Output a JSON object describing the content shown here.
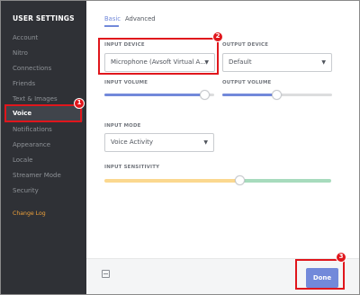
{
  "sidebar": {
    "title": "USER SETTINGS",
    "items": [
      "Account",
      "Nitro",
      "Connections",
      "Friends",
      "Text & Images",
      "Voice",
      "Notifications",
      "Appearance",
      "Locale",
      "Streamer Mode",
      "Security"
    ],
    "active_index": 5,
    "changelog_label": "Change Log"
  },
  "tabs": {
    "basic": "Basic",
    "advanced": "Advanced"
  },
  "input_device": {
    "label": "INPUT DEVICE",
    "value": "Microphone (Avsoft Virtual A..."
  },
  "output_device": {
    "label": "OUTPUT DEVICE",
    "value": "Default"
  },
  "input_volume": {
    "label": "INPUT VOLUME",
    "level_percent": 100
  },
  "output_volume": {
    "label": "OUTPUT VOLUME",
    "level_percent": 50
  },
  "input_mode": {
    "label": "INPUT MODE",
    "value": "Voice Activity"
  },
  "input_sensitivity": {
    "label": "INPUT SENSITIVITY",
    "level_percent": 60
  },
  "footer": {
    "done_label": "Done"
  },
  "annotations": [
    "1",
    "2",
    "3"
  ],
  "colors": {
    "accent": "#7289da",
    "sidebar": "#2f3136",
    "annotation": "#e0161c",
    "sensitivity_low": "#fbd88f",
    "sensitivity_high": "#a7dbbd",
    "changelog": "#f0a23a"
  },
  "icons": {
    "dropdown": "chevron-down-icon",
    "footer": "screen-icon"
  }
}
